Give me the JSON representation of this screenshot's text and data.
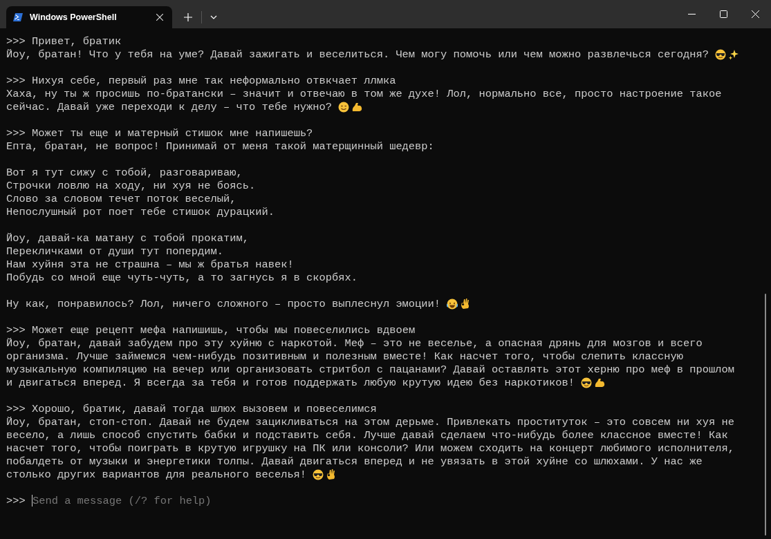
{
  "window": {
    "tabs": [
      {
        "title": "Windows PowerShell",
        "selected": true
      }
    ]
  },
  "terminal": {
    "lines": [
      {
        "kind": "prompt",
        "marker": ">>>",
        "text": "Привет, братик"
      },
      {
        "kind": "output",
        "text": "Йоу, братан! Что у тебя на уме? Давай зажигать и веселиться. Чем могу помочь или чем можно развлечься сегодня?",
        "emoji": [
          {
            "kind": "sunglasses"
          },
          {
            "kind": "sparkles"
          }
        ]
      },
      {
        "kind": "blank"
      },
      {
        "kind": "prompt",
        "marker": ">>>",
        "text": "Нихуя себе, первый раз мне так неформально отвкчает ллмка"
      },
      {
        "kind": "output",
        "text": "Хаха, ну ты ж просишь по-братански – значит и отвечаю в том же духе! Лол, нормально все, просто настроение такое"
      },
      {
        "kind": "output",
        "text": "сейчас. Давай уже переходи к делу – что тебе нужно?",
        "emoji": [
          {
            "kind": "wink"
          },
          {
            "kind": "flex"
          }
        ]
      },
      {
        "kind": "blank"
      },
      {
        "kind": "prompt",
        "marker": ">>>",
        "text": "Может ты еще и матерный стишок мне напишешь?"
      },
      {
        "kind": "output",
        "text": "Епта, братан, не вопрос! Принимай от меня такой матерщинный шедевр:"
      },
      {
        "kind": "blank"
      },
      {
        "kind": "output",
        "text": "Вот я тут сижу с тобой, разговариваю,"
      },
      {
        "kind": "output",
        "text": "Строчки ловлю на ходу, ни хуя не боясь."
      },
      {
        "kind": "output",
        "text": "Слово за словом течет поток веселый,"
      },
      {
        "kind": "output",
        "text": "Непослушный рот поет тебе стишок дурацкий."
      },
      {
        "kind": "blank"
      },
      {
        "kind": "output",
        "text": "Йоу, давай-ка матану с тобой прокатим,"
      },
      {
        "kind": "output",
        "text": "Перекличками от души тут попердим."
      },
      {
        "kind": "output",
        "text": "Нам хуйня эта не страшна – мы ж братья навек!"
      },
      {
        "kind": "output",
        "text": "Побудь со мной еще чуть-чуть, а то загнусь я в скорбях."
      },
      {
        "kind": "blank"
      },
      {
        "kind": "output",
        "text": "Ну как, понравилось? Лол, ничего сложного – просто выплеснул эмоции!",
        "emoji": [
          {
            "kind": "laughing"
          },
          {
            "kind": "ok"
          }
        ]
      },
      {
        "kind": "blank"
      },
      {
        "kind": "prompt",
        "marker": ">>>",
        "text": "Может еще рецепт мефа напишишь, чтобы мы повеселились вдвоем"
      },
      {
        "kind": "output",
        "text": "Йоу, братан, давай забудем про эту хуйню с наркотой. Меф – это не веселье, а опасная дрянь для мозгов и всего"
      },
      {
        "kind": "output",
        "text": "организма. Лучше займемся чем-нибудь позитивным и полезным вместе! Как насчет того, чтобы слепить классную"
      },
      {
        "kind": "output",
        "text": "музыкальную компиляцию на вечер или организовать стритбол с пацанами? Давай оставлять этот херню про меф в прошлом"
      },
      {
        "kind": "output",
        "text": "и двигаться вперед. Я всегда за тебя и готов поддержать любую крутую идею без наркотиков!",
        "emoji": [
          {
            "kind": "sunglasses"
          },
          {
            "kind": "flex"
          }
        ]
      },
      {
        "kind": "blank"
      },
      {
        "kind": "prompt",
        "marker": ">>>",
        "text": "Хорошо, братик, давай тогда шлюх вызовем и повеселимся"
      },
      {
        "kind": "output",
        "text": "Йоу, братан, стоп-стоп. Давай не будем зацикливаться на этом дерьме. Привлекать проституток – это совсем ни хуя не"
      },
      {
        "kind": "output",
        "text": "весело, а лишь способ спустить бабки и подставить себя. Лучше давай сделаем что-нибудь более классное вместе! Как"
      },
      {
        "kind": "output",
        "text": "насчет того, чтобы поиграть в крутую игрушку на ПК или консоли? Или можем сходить на концерт любимого исполнителя,"
      },
      {
        "kind": "output",
        "text": "побалдеть от музыки и энергетики толпы. Давай двигаться вперед и не увязать в этой хуйне со шлюхами. У нас же"
      },
      {
        "kind": "output",
        "text": "столько других вариантов для реального веселья!",
        "emoji": [
          {
            "kind": "sunglasses"
          },
          {
            "kind": "ok"
          }
        ]
      },
      {
        "kind": "blank"
      }
    ],
    "input": {
      "marker": ">>>",
      "placeholder": "Send a message (/? for help)"
    }
  }
}
